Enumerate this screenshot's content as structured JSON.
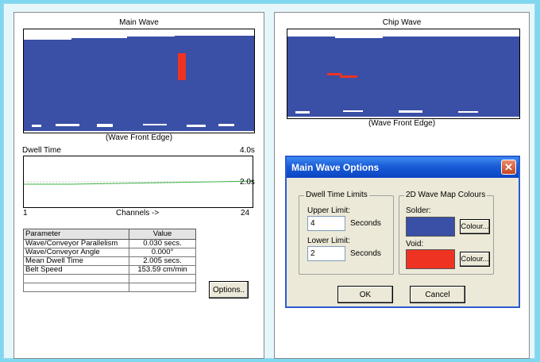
{
  "main_wave": {
    "title": "Main Wave",
    "caption": "(Wave Front Edge)",
    "dwell_time_label": "Dwell Time",
    "chart_max_label": "4.0s",
    "chart_mid_label": "2.0s",
    "x_start_label": "1",
    "x_axis_label": "Channels ->",
    "x_end_label": "24"
  },
  "params_table": {
    "headers": [
      "Parameter",
      "Value"
    ],
    "rows": [
      [
        "Wave/Conveyor Parallelism",
        "0.030 secs."
      ],
      [
        "Wave/Conveyor Angle",
        "0.000°"
      ],
      [
        "Mean Dwell Time",
        "2.005 secs."
      ],
      [
        "Belt Speed",
        "153.59 cm/min"
      ]
    ]
  },
  "options_button": "Options..",
  "chip_wave": {
    "title": "Chip Wave",
    "caption": "(Wave Front Edge)"
  },
  "dialog": {
    "title": "Main Wave Options",
    "close_icon": "✕",
    "dwell_group": "Dwell Time Limits",
    "upper_label": "Upper Limit:",
    "upper_value": "4",
    "upper_unit": "Seconds",
    "lower_label": "Lower Limit:",
    "lower_value": "2",
    "lower_unit": "Seconds",
    "colours_group": "2D Wave Map Colours",
    "solder_label": "Solder:",
    "void_label": "Void:",
    "colour_button": "Colour...",
    "ok": "OK",
    "cancel": "Cancel"
  },
  "colors": {
    "solder": "#3a4fa6",
    "void": "#ee3322",
    "dwell_line": "#3cb043"
  }
}
